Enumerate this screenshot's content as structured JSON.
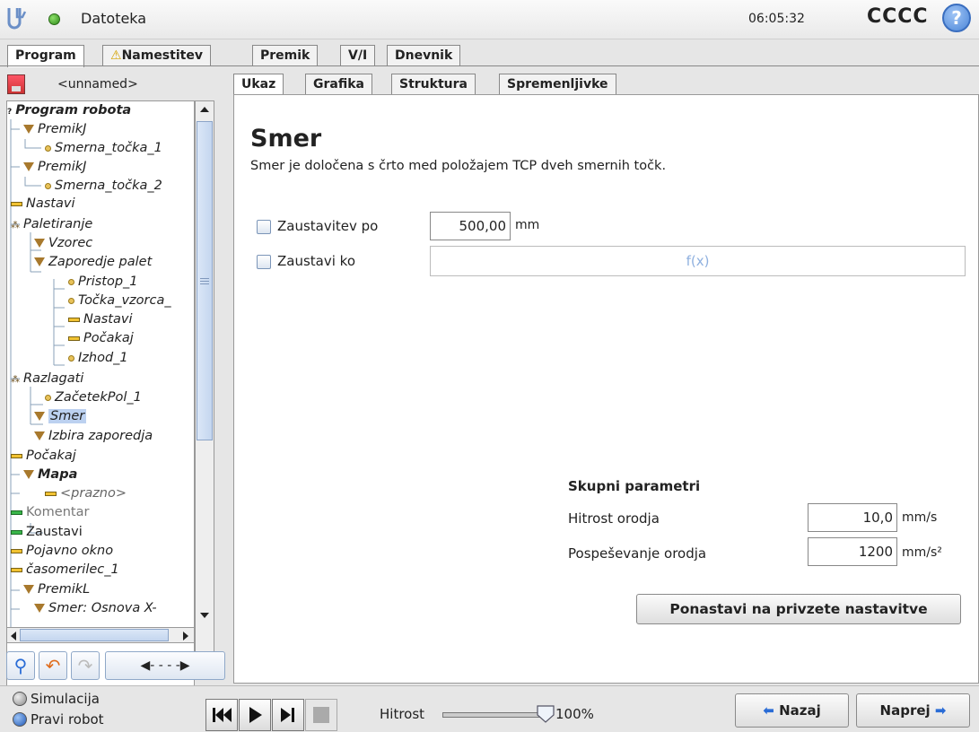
{
  "header": {
    "app_title": "Datoteka",
    "time": "06:05:32",
    "robot_name": "CCCC",
    "help_label": "?"
  },
  "main_tabs": [
    {
      "label": "Program",
      "active": true
    },
    {
      "label": "Namestitev",
      "warning": true
    },
    {
      "label": "Premik"
    },
    {
      "label": "V/I"
    },
    {
      "label": "Dnevnik"
    }
  ],
  "left": {
    "program_name": "<unnamed>",
    "tree": [
      {
        "label": "Program robota",
        "icon": "root",
        "bold": true
      },
      {
        "label": "PremikJ",
        "icon": "move"
      },
      {
        "label": "Smerna_točka_1",
        "icon": "waypoint"
      },
      {
        "label": "PremikJ",
        "icon": "move"
      },
      {
        "label": "Smerna_točka_2",
        "icon": "waypoint"
      },
      {
        "label": "Nastavi",
        "icon": "set"
      },
      {
        "label": "Paletiranje",
        "icon": "pallet"
      },
      {
        "label": "Vzorec",
        "icon": "move"
      },
      {
        "label": "Zaporedje palet",
        "icon": "move"
      },
      {
        "label": "Pristop_1",
        "icon": "waypoint"
      },
      {
        "label": "Točka_vzorca_",
        "icon": "waypoint"
      },
      {
        "label": "Nastavi",
        "icon": "set"
      },
      {
        "label": "Počakaj",
        "icon": "set"
      },
      {
        "label": "Izhod_1",
        "icon": "waypoint"
      },
      {
        "label": "Razlagati",
        "icon": "pallet"
      },
      {
        "label": "ZačetekPol_1",
        "icon": "waypoint"
      },
      {
        "label": "Smer",
        "icon": "move",
        "selected": true
      },
      {
        "label": "Izbira zaporedja",
        "icon": "move"
      },
      {
        "label": "Počakaj",
        "icon": "set"
      },
      {
        "label": "Mapa",
        "icon": "move",
        "bold": true
      },
      {
        "label": "<prazno>",
        "icon": "set"
      },
      {
        "label": "Komentar",
        "icon": "comment"
      },
      {
        "label": "Zaustavi",
        "icon": "comment"
      },
      {
        "label": "Pojavno okno",
        "icon": "set"
      },
      {
        "label": "časomerilec_1",
        "icon": "set"
      },
      {
        "label": "PremikL",
        "icon": "move"
      },
      {
        "label": "Smer: Osnova X-",
        "icon": "move"
      }
    ]
  },
  "sub_tabs": [
    {
      "label": "Ukaz",
      "active": true
    },
    {
      "label": "Grafika"
    },
    {
      "label": "Struktura"
    },
    {
      "label": "Spremenljivke"
    }
  ],
  "command": {
    "title": "Smer",
    "description": "Smer je določena s črto med položajem TCP dveh smernih točk.",
    "stop_after_label": "Zaustavitev po",
    "stop_after_value": "500,00",
    "stop_after_unit": "mm",
    "stop_when_label": "Zaustavi ko",
    "stop_when_value": "f(x)"
  },
  "shared": {
    "title": "Skupni parametri",
    "tool_speed_label": "Hitrost orodja",
    "tool_speed_value": "10,0",
    "tool_speed_unit": "mm/s",
    "tool_accel_label": "Pospeševanje orodja",
    "tool_accel_value": "1200",
    "tool_accel_unit": "mm/s²",
    "reset_label": "Ponastavi na privzete nastavitve"
  },
  "bottom": {
    "simulation_label": "Simulacija",
    "real_robot_label": "Pravi robot",
    "speed_label": "Hitrost",
    "speed_value": "100%",
    "speed_fraction": 1.0,
    "back_label": "Nazaj",
    "next_label": "Naprej"
  },
  "colors": {
    "accent_blue": "#3a6ebf",
    "selected_bg": "#bcd1f0",
    "fx_text": "#8fb0df"
  }
}
